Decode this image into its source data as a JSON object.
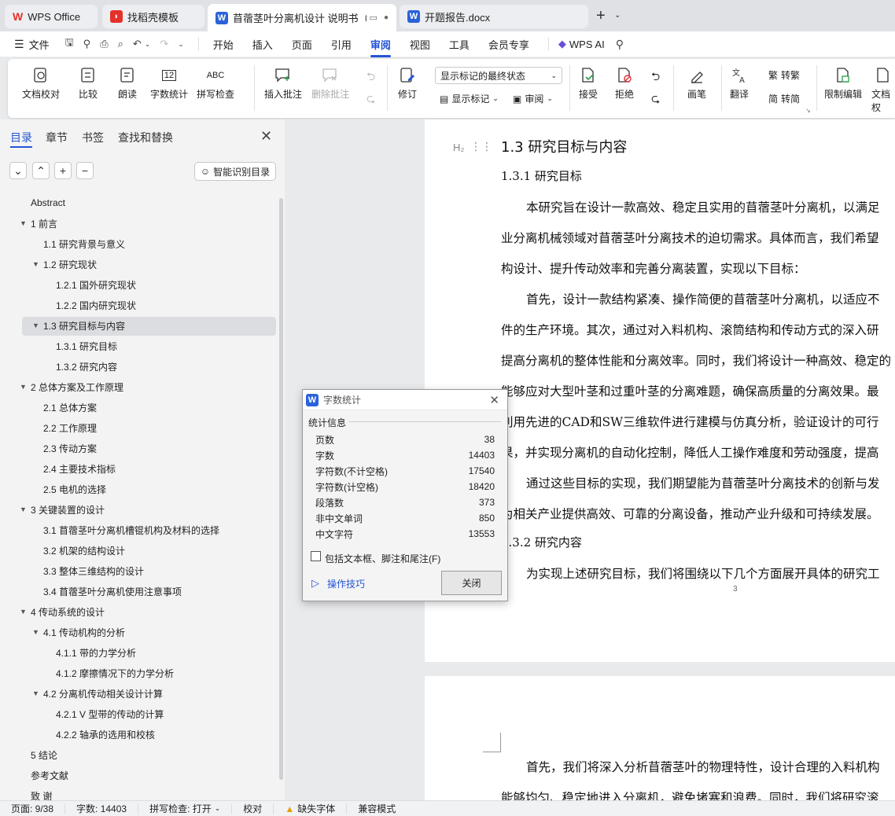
{
  "tabs": [
    {
      "label": "WPS Office",
      "icon": "wps-logo-icon"
    },
    {
      "label": "找稻壳模板",
      "icon": "docer-icon"
    },
    {
      "label": "苜蓿茎叶分离机设计 说明书（",
      "icon": "word-doc-icon",
      "active": true
    },
    {
      "label": "开题报告.docx",
      "icon": "word-doc-icon"
    }
  ],
  "menu": {
    "file": "文件",
    "items": [
      "开始",
      "插入",
      "页面",
      "引用",
      "审阅",
      "视图",
      "工具",
      "会员专享"
    ],
    "active": "审阅",
    "ai": "WPS AI"
  },
  "ribbon": {
    "doc_check": "文档校对",
    "compare": "比较",
    "read_aloud": "朗读",
    "word_count": "字数统计",
    "spell_check": "拼写检查",
    "spell_icon_text": "ABC",
    "count_icon_text": "12",
    "insert_comment": "插入批注",
    "delete_comment": "删除批注",
    "track": "修订",
    "markup_select": "显示标记的最终状态",
    "show_markup": "显示标记",
    "review": "审阅",
    "accept": "接受",
    "reject": "拒绝",
    "pen": "画笔",
    "translate": "翻译",
    "to_trad": "转繁",
    "to_simp": "转简",
    "restrict": "限制编辑",
    "doc_perm": "文档权"
  },
  "left_panel": {
    "tabs": [
      "目录",
      "章节",
      "书签",
      "查找和替换"
    ],
    "smart_btn": "智能识别目录",
    "toc": [
      {
        "label": "Abstract",
        "level": 1,
        "caret": ""
      },
      {
        "label": "1  前言",
        "level": 1,
        "caret": "▼"
      },
      {
        "label": "1.1  研究背景与意义",
        "level": 2,
        "caret": ""
      },
      {
        "label": "1.2  研究现状",
        "level": 2,
        "caret": "▼"
      },
      {
        "label": "1.2.1  国外研究现状",
        "level": 3,
        "caret": ""
      },
      {
        "label": "1.2.2  国内研究现状",
        "level": 3,
        "caret": ""
      },
      {
        "label": "1.3  研究目标与内容",
        "level": 2,
        "caret": "▼",
        "selected": true
      },
      {
        "label": "1.3.1  研究目标",
        "level": 3,
        "caret": ""
      },
      {
        "label": "1.3.2  研究内容",
        "level": 3,
        "caret": ""
      },
      {
        "label": "2  总体方案及工作原理",
        "level": 1,
        "caret": "▼"
      },
      {
        "label": "2.1  总体方案",
        "level": 2,
        "caret": ""
      },
      {
        "label": "2.2  工作原理",
        "level": 2,
        "caret": ""
      },
      {
        "label": "2.3  传动方案",
        "level": 2,
        "caret": ""
      },
      {
        "label": "2.4  主要技术指标",
        "level": 2,
        "caret": ""
      },
      {
        "label": "2.5  电机的选择",
        "level": 2,
        "caret": ""
      },
      {
        "label": "3 关键装置的设计",
        "level": 1,
        "caret": "▼"
      },
      {
        "label": "3.1 苜蓿茎叶分离机槽锟机构及材料的选择",
        "level": 2,
        "caret": ""
      },
      {
        "label": "3.2  机架的结构设计",
        "level": 2,
        "caret": ""
      },
      {
        "label": "3.3  整体三维结构的设计",
        "level": 2,
        "caret": ""
      },
      {
        "label": "3.4  苜蓿茎叶分离机使用注意事项",
        "level": 2,
        "caret": ""
      },
      {
        "label": "4  传动系统的设计",
        "level": 1,
        "caret": "▼"
      },
      {
        "label": "4.1  传动机构的分析",
        "level": 2,
        "caret": "▼"
      },
      {
        "label": "4.1.1  带的力学分析",
        "level": 3,
        "caret": ""
      },
      {
        "label": "4.1.2  摩擦情况下的力学分析",
        "level": 3,
        "caret": ""
      },
      {
        "label": "4.2  分离机传动相关设计计算",
        "level": 2,
        "caret": "▼"
      },
      {
        "label": "4.2.1 V 型带的传动的计算",
        "level": 3,
        "caret": ""
      },
      {
        "label": "4.2.2  轴承的选用和校核",
        "level": 3,
        "caret": ""
      },
      {
        "label": "5  结论",
        "level": 1,
        "caret": ""
      },
      {
        "label": "参考文献",
        "level": 1,
        "caret": ""
      },
      {
        "label": "致    谢",
        "level": 1,
        "caret": ""
      }
    ]
  },
  "document": {
    "h2_marker": "H₂",
    "heading": "1.3  研究目标与内容",
    "sub1": "1.3.1  研究目标",
    "lines": [
      "本研究旨在设计一款高效、稳定且实用的苜蓿茎叶分离机，以满足",
      "业分离机械领域对苜蓿茎叶分离技术的迫切需求。具体而言，我们希望",
      "构设计、提升传动效率和完善分离装置，实现以下目标：",
      "首先，设计一款结构紧凑、操作简便的苜蓿茎叶分离机，以适应不",
      "件的生产环境。其次，通过对入料机构、滚筒结构和传动方式的深入研",
      "提高分离机的整体性能和分离效率。同时，我们将设计一种高效、稳定的",
      "能够应对大型叶茎和过重叶茎的分离难题，确保高质量的分离效果。最",
      "利用先进的CAD和SW三维软件进行建模与仿真分析，验证设计的可行",
      "果，并实现分离机的自动化控制，降低人工操作难度和劳动强度，提高",
      "通过这些目标的实现，我们期望能为苜蓿茎叶分离技术的创新与发",
      "为相关产业提供高效、可靠的分离设备，推动产业升级和可持续发展。"
    ],
    "sub2": "1.3.2  研究内容",
    "line_sub2": "为实现上述研究目标，我们将围绕以下几个方面展开具体的研究工",
    "page_num": "3",
    "page2_lines": [
      "首先，我们将深入分析苜蓿茎叶的物理特性，设计合理的入料机构",
      "能够均匀、稳定地进入分离机，避免堵塞和浪费。同时，我们将研究滚"
    ]
  },
  "dialog": {
    "title": "字数统计",
    "section": "统计信息",
    "rows": [
      {
        "label": "页数",
        "value": "38"
      },
      {
        "label": "字数",
        "value": "14403"
      },
      {
        "label": "字符数(不计空格)",
        "value": "17540"
      },
      {
        "label": "字符数(计空格)",
        "value": "18420"
      },
      {
        "label": "段落数",
        "value": "373"
      },
      {
        "label": "非中文单词",
        "value": "850"
      },
      {
        "label": "中文字符",
        "value": "13553"
      }
    ],
    "checkbox_label": "包括文本框、脚注和尾注(F)",
    "tips": "操作技巧",
    "close": "关闭"
  },
  "status": {
    "page": "页面: 9/38",
    "words": "字数: 14403",
    "spell": "拼写检查: 打开",
    "proof": "校对",
    "missing_font": "缺失字体",
    "compat": "兼容模式"
  },
  "colors": {
    "accent": "#2454d6",
    "wps_red": "#e5312a",
    "word_blue": "#2b62d9"
  }
}
